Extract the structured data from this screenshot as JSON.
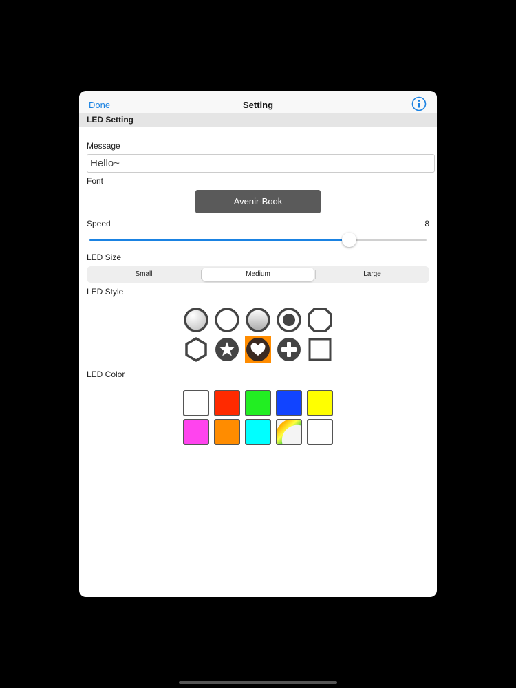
{
  "navbar": {
    "done_label": "Done",
    "title": "Setting",
    "info_icon": "info-icon"
  },
  "section": {
    "title": "LED Setting"
  },
  "message": {
    "label": "Message",
    "value": "Hello~"
  },
  "font": {
    "label": "Font",
    "value": "Avenir-Book"
  },
  "speed": {
    "label": "Speed",
    "value": "8",
    "level": 0.77
  },
  "led_size": {
    "label": "LED Size",
    "options": [
      "Small",
      "Medium",
      "Large"
    ],
    "selected": "Medium"
  },
  "led_style": {
    "label": "LED Style",
    "selected": "heart",
    "styles": [
      "sphere-light",
      "ring",
      "sphere-gradient",
      "ring-dot",
      "rounded-square",
      "hexagon",
      "star",
      "heart",
      "plus",
      "square"
    ]
  },
  "led_color": {
    "label": "LED Color",
    "colors": [
      "#ffffff",
      "#ff2a00",
      "#22ee22",
      "#1144ff",
      "#ffff00",
      "#ff44ee",
      "#ff8c00",
      "#00ffff",
      "rainbow",
      "#ffffff"
    ]
  }
}
